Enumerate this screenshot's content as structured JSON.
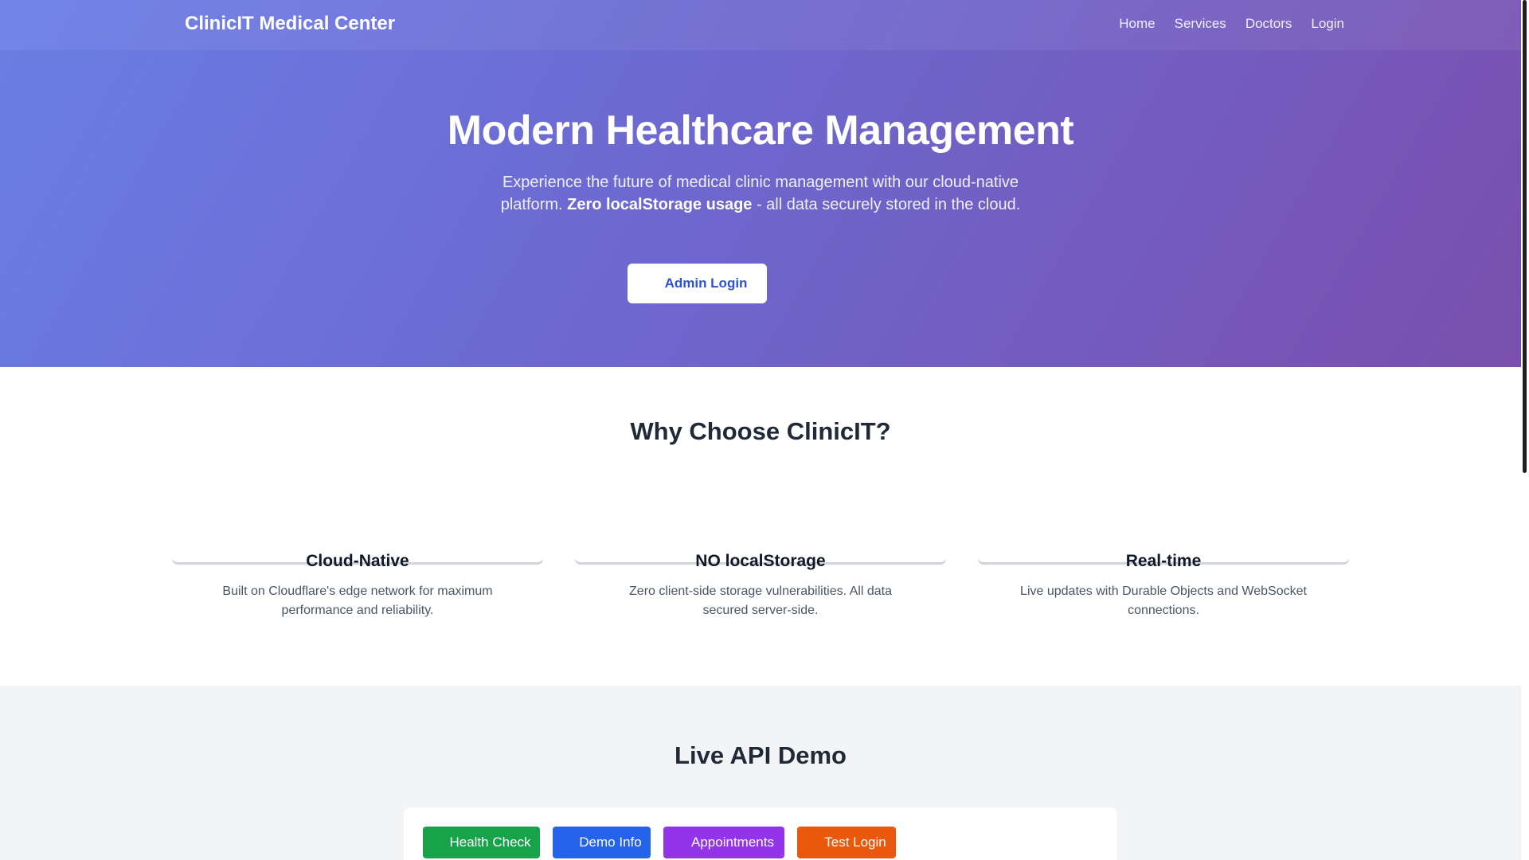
{
  "nav": {
    "brand": "ClinicIT Medical Center",
    "links": [
      "Home",
      "Services",
      "Doctors",
      "Login"
    ]
  },
  "hero": {
    "title": "Modern Healthcare Management",
    "subtitle_before": "Experience the future of medical clinic management with our cloud-native platform.",
    "subtitle_bold": "Zero localStorage usage",
    "subtitle_after": "- all data securely stored in the cloud.",
    "button_label": "Admin Login",
    "button_icon": "login-icon"
  },
  "features": {
    "title": "Why Choose ClinicIT?",
    "cards": [
      {
        "icon": "cloud-icon",
        "title": "Cloud-Native",
        "description": "Built on Cloudflare's edge network for maximum performance and reliability."
      },
      {
        "icon": "shield-icon",
        "title": "NO localStorage",
        "description": "Zero client-side storage vulnerabilities. All data secured server-side."
      },
      {
        "icon": "bolt-icon",
        "title": "Real-time",
        "description": "Live updates with Durable Objects and WebSocket connections."
      }
    ]
  },
  "demo": {
    "title": "Live API Demo",
    "buttons": [
      {
        "label": "Health Check",
        "color": "#16a34a",
        "icon": "heartbeat-icon"
      },
      {
        "label": "Demo Info",
        "color": "#2563eb",
        "icon": "info-icon"
      },
      {
        "label": "Appointments",
        "color": "#9333ea",
        "icon": "calendar-icon"
      },
      {
        "label": "Test Login",
        "color": "#ea580c",
        "icon": "key-icon"
      }
    ]
  },
  "colors": {
    "hero_gradient_start": "#6a7ee6",
    "hero_gradient_end": "#7a4fae",
    "admin_button_text": "#2d52d0"
  }
}
